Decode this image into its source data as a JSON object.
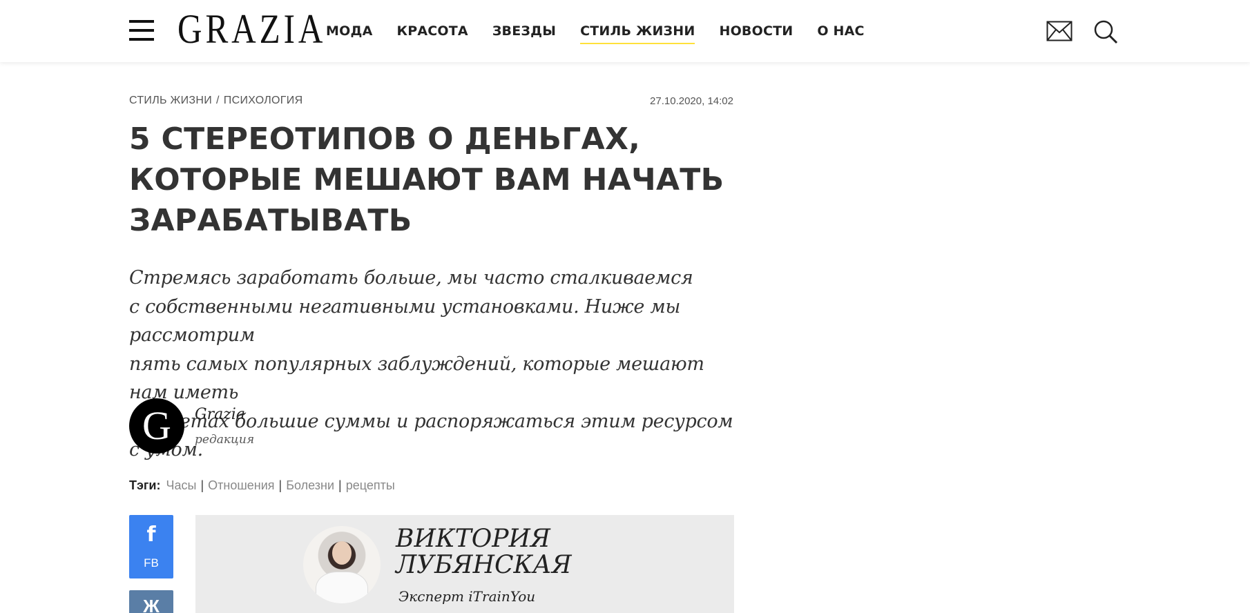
{
  "header": {
    "logo": "GRAZIA",
    "nav": [
      "МОДА",
      "КРАСОТА",
      "ЗВЕЗДЫ",
      "СТИЛЬ ЖИЗНИ",
      "НОВОСТИ",
      "О НАС"
    ],
    "active_nav": "СТИЛЬ ЖИЗНИ",
    "icons": [
      "menu-icon",
      "mail-icon",
      "search-icon"
    ],
    "accent_color": "#ffe13a"
  },
  "article": {
    "breadcrumb": [
      "СТИЛЬ ЖИЗНИ",
      "ПСИХОЛОГИЯ"
    ],
    "breadcrumb_separator": "/",
    "date": "27.10.2020, 14:02",
    "title_lines": [
      "5 СТЕРЕОТИПОВ О ДЕНЬГАХ,",
      "КОТОРЫЕ МЕШАЮТ ВАМ НАЧАТЬ",
      "ЗАРАБАТЫВАТЬ"
    ],
    "lead_lines": [
      "Стремясь заработать больше, мы часто сталкиваемся",
      "с собственными негативными установками. Ниже мы рассмотрим",
      "пять самых популярных заблуждений, которые мешают нам иметь",
      "на счетах большие суммы и распоряжаться этим ресурсом с умом."
    ],
    "author": {
      "avatar_letter": "G",
      "name": "Grazia",
      "role": "редакция"
    },
    "tags_label": "Тэги:",
    "tags": [
      "Часы",
      "Отношения",
      "Болезни",
      "рецепты"
    ]
  },
  "share": {
    "fb_label": "FB",
    "fb_glyph": "f",
    "vk_glyph": "Ж",
    "fb_color": "#3b82f0",
    "vk_color": "#5a7ea6"
  },
  "expert": {
    "name_lines": [
      "ВИКТОРИЯ",
      "ЛУБЯНСКАЯ"
    ],
    "role": "Эксперт iTrainYou"
  }
}
